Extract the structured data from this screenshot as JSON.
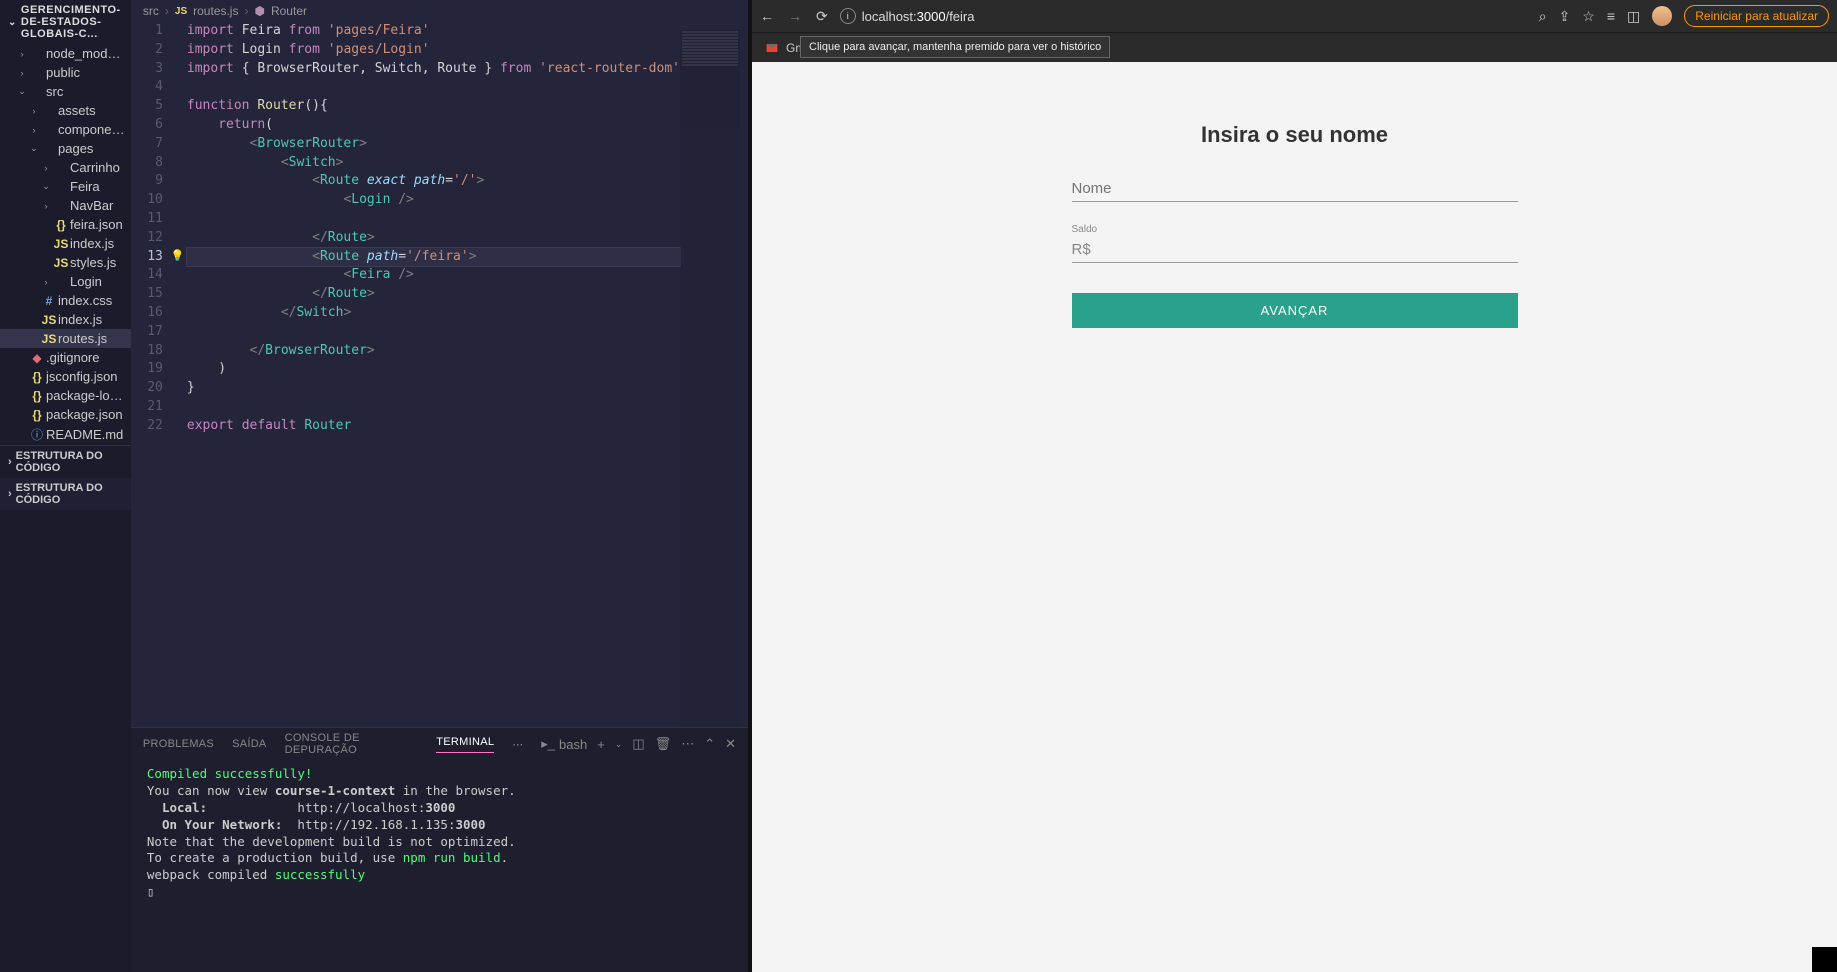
{
  "explorer": {
    "title": "GERENCIMENTO-DE-ESTADOS-GLOBAIS-C...",
    "tree": [
      {
        "label": "node_modules",
        "chev": "›",
        "indent": 1,
        "icon": "",
        "cls": "icon-folder"
      },
      {
        "label": "public",
        "chev": "›",
        "indent": 1,
        "icon": "",
        "cls": "icon-folder"
      },
      {
        "label": "src",
        "chev": "⌄",
        "indent": 1,
        "icon": "",
        "cls": "icon-folder"
      },
      {
        "label": "assets",
        "chev": "›",
        "indent": 2,
        "icon": "",
        "cls": "icon-folder"
      },
      {
        "label": "components",
        "chev": "›",
        "indent": 2,
        "icon": "",
        "cls": "icon-folder"
      },
      {
        "label": "pages",
        "chev": "⌄",
        "indent": 2,
        "icon": "",
        "cls": "icon-folder"
      },
      {
        "label": "Carrinho",
        "chev": "›",
        "indent": 3,
        "icon": "",
        "cls": "icon-folder"
      },
      {
        "label": "Feira",
        "chev": "⌄",
        "indent": 3,
        "icon": "",
        "cls": "icon-folder"
      },
      {
        "label": "NavBar",
        "chev": "›",
        "indent": 3,
        "icon": "",
        "cls": "icon-folder"
      },
      {
        "label": "feira.json",
        "chev": "",
        "indent": 3,
        "icon": "{}",
        "cls": "icon-json"
      },
      {
        "label": "index.js",
        "chev": "",
        "indent": 3,
        "icon": "JS",
        "cls": "icon-js"
      },
      {
        "label": "styles.js",
        "chev": "",
        "indent": 3,
        "icon": "JS",
        "cls": "icon-js"
      },
      {
        "label": "Login",
        "chev": "›",
        "indent": 3,
        "icon": "",
        "cls": "icon-folder"
      },
      {
        "label": "index.css",
        "chev": "",
        "indent": 2,
        "icon": "#",
        "cls": "icon-css"
      },
      {
        "label": "index.js",
        "chev": "",
        "indent": 2,
        "icon": "JS",
        "cls": "icon-js"
      },
      {
        "label": "routes.js",
        "chev": "",
        "indent": 2,
        "icon": "JS",
        "cls": "icon-js",
        "active": true
      },
      {
        "label": ".gitignore",
        "chev": "",
        "indent": 1,
        "icon": "◆",
        "cls": "icon-git"
      },
      {
        "label": "jsconfig.json",
        "chev": "",
        "indent": 1,
        "icon": "{}",
        "cls": "icon-json"
      },
      {
        "label": "package-lock.json",
        "chev": "",
        "indent": 1,
        "icon": "{}",
        "cls": "icon-json"
      },
      {
        "label": "package.json",
        "chev": "",
        "indent": 1,
        "icon": "{}",
        "cls": "icon-json"
      },
      {
        "label": "README.md",
        "chev": "",
        "indent": 1,
        "icon": "ⓘ",
        "cls": "icon-info"
      }
    ],
    "outline_header": "ESTRUTURA DO CÓDIGO",
    "outline_item": "ESTRUTURA DO CÓDIGO"
  },
  "breadcrumb": {
    "p1": "src",
    "p2": "routes.js",
    "p3": "Router",
    "icon": "JS"
  },
  "code": {
    "lines": [
      {
        "n": 1,
        "html": "<span class='tk-keyword'>import</span> <span class='tk-name'>Feira</span> <span class='tk-keyword'>from</span> <span class='tk-string'>'pages/Feira'</span>"
      },
      {
        "n": 2,
        "html": "<span class='tk-keyword'>import</span> <span class='tk-name'>Login</span> <span class='tk-keyword'>from</span> <span class='tk-string'>'pages/Login'</span>"
      },
      {
        "n": 3,
        "html": "<span class='tk-keyword'>import</span> <span class='tk-name'>{ BrowserRouter, Switch, Route }</span> <span class='tk-keyword'>from</span> <span class='tk-string'>'react-router-dom'</span>"
      },
      {
        "n": 4,
        "html": ""
      },
      {
        "n": 5,
        "html": "<span class='tk-keyword'>function</span> <span class='tk-func'>Router</span><span class='tk-name'>(){</span>"
      },
      {
        "n": 6,
        "html": "    <span class='tk-keyword'>return</span><span class='tk-name'>(</span>"
      },
      {
        "n": 7,
        "html": "        <span class='tk-punct'>&lt;</span><span class='tk-tag'>BrowserRouter</span><span class='tk-punct'>&gt;</span>"
      },
      {
        "n": 8,
        "html": "            <span class='tk-punct'>&lt;</span><span class='tk-tag'>Switch</span><span class='tk-punct'>&gt;</span>"
      },
      {
        "n": 9,
        "html": "                <span class='tk-punct'>&lt;</span><span class='tk-tag'>Route</span> <span class='tk-attr'>exact</span> <span class='tk-attr'>path</span><span class='tk-name'>=</span><span class='tk-string'>'/'</span><span class='tk-punct'>&gt;</span>"
      },
      {
        "n": 10,
        "html": "                    <span class='tk-punct'>&lt;</span><span class='tk-tag'>Login</span> <span class='tk-punct'>/&gt;</span>"
      },
      {
        "n": 11,
        "html": ""
      },
      {
        "n": 12,
        "html": "                <span class='tk-punct'>&lt;/</span><span class='tk-tag'>Route</span><span class='tk-punct'>&gt;</span>"
      },
      {
        "n": 13,
        "html": "                <span class='tk-punct'>&lt;</span><span class='tk-tag'>Route</span> <span class='tk-attr'>path</span><span class='tk-name'>=</span><span class='tk-string'>'/feira'</span><span class='tk-punct'>&gt;</span>",
        "hl": true,
        "bulb": true
      },
      {
        "n": 14,
        "html": "                    <span class='tk-punct'>&lt;</span><span class='tk-tag'>Feira</span> <span class='tk-punct'>/&gt;</span>"
      },
      {
        "n": 15,
        "html": "                <span class='tk-punct'>&lt;/</span><span class='tk-tag'>Route</span><span class='tk-punct'>&gt;</span>"
      },
      {
        "n": 16,
        "html": "            <span class='tk-punct'>&lt;/</span><span class='tk-tag'>Switch</span><span class='tk-punct'>&gt;</span>"
      },
      {
        "n": 17,
        "html": ""
      },
      {
        "n": 18,
        "html": "        <span class='tk-punct'>&lt;/</span><span class='tk-tag'>BrowserRouter</span><span class='tk-punct'>&gt;</span>"
      },
      {
        "n": 19,
        "html": "    <span class='tk-name'>)</span>"
      },
      {
        "n": 20,
        "html": "<span class='tk-name'>}</span>"
      },
      {
        "n": 21,
        "html": ""
      },
      {
        "n": 22,
        "html": "<span class='tk-keyword'>export</span> <span class='tk-keyword'>default</span> <span class='tk-default'>Router</span>"
      }
    ]
  },
  "terminal": {
    "tabs": {
      "problems": "PROBLEMAS",
      "output": "SAÍDA",
      "debug": "CONSOLE DE DEPURAÇÃO",
      "terminal": "TERMINAL"
    },
    "shell": "bash",
    "lines": [
      {
        "cls": "t-green",
        "text": "Compiled successfully!"
      },
      {
        "text": ""
      },
      {
        "html": "You can now view <span class='t-bold'>course-1-context</span> in the browser."
      },
      {
        "text": ""
      },
      {
        "html": "  <span class='t-bold'>Local:</span>            http://localhost:<span class='t-bold'>3000</span>"
      },
      {
        "html": "  <span class='t-bold'>On Your Network:</span>  http://192.168.1.135:<span class='t-bold'>3000</span>"
      },
      {
        "text": ""
      },
      {
        "text": "Note that the development build is not optimized."
      },
      {
        "html": "To create a production build, use <span class='t-green'>npm run build</span>."
      },
      {
        "text": ""
      },
      {
        "html": "webpack compiled <span class='t-green'>successfully</span>"
      },
      {
        "text": "▯"
      }
    ]
  },
  "browser": {
    "url_host": "localhost:",
    "url_port": "3000",
    "url_path": "/feira",
    "tooltip": "Clique para avançar, mantenha premido para ver o histórico",
    "gmail": "Gmail",
    "restart": "Reiniciar para atualizar",
    "form": {
      "title": "Insira o seu nome",
      "name_placeholder": "Nome",
      "balance_label": "Saldo",
      "balance_value": "R$",
      "submit": "AVANÇAR"
    }
  }
}
